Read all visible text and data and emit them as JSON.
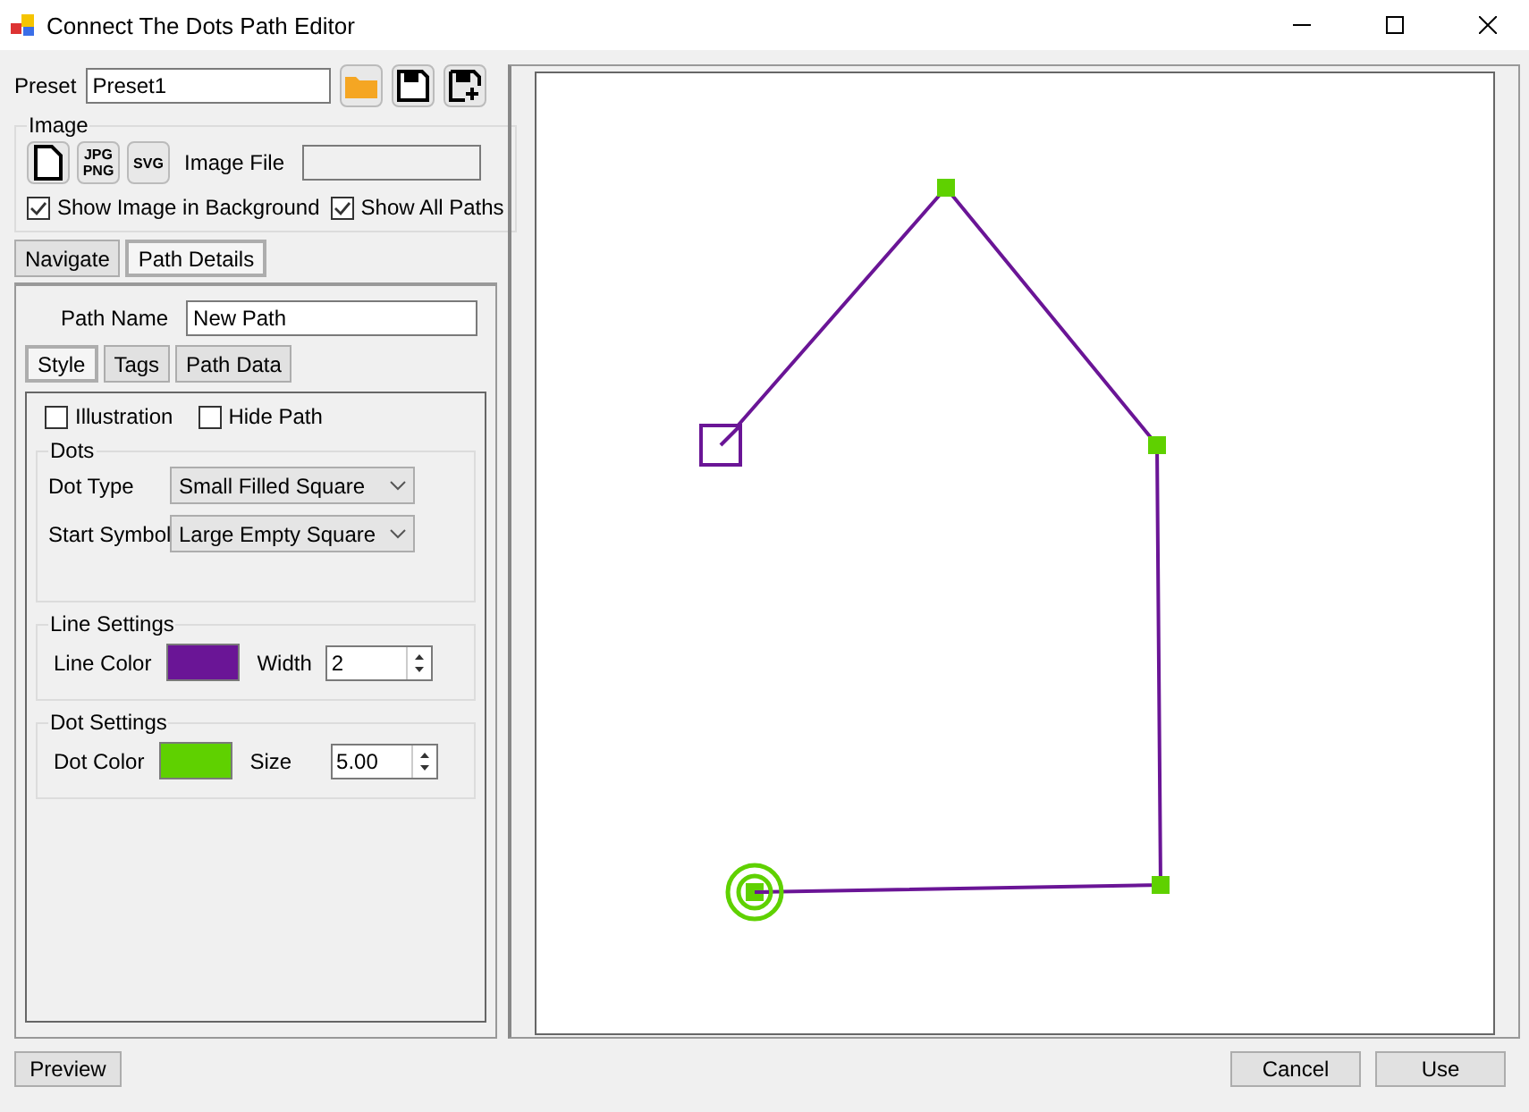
{
  "window": {
    "title": "Connect The Dots Path Editor"
  },
  "preset": {
    "label": "Preset",
    "value": "Preset1"
  },
  "image": {
    "title": "Image",
    "file_label": "Image File",
    "buttons": [
      {
        "kind": "file"
      },
      {
        "kind": "jpgpng",
        "lines": [
          "JPG",
          "PNG"
        ]
      },
      {
        "kind": "svg",
        "lines": [
          "SVG"
        ]
      }
    ],
    "options": [
      {
        "label": "Show Image in Background",
        "checked": true
      },
      {
        "label": "Show All Paths",
        "checked": true
      }
    ]
  },
  "tabs": [
    {
      "label": "Navigate",
      "selected": false
    },
    {
      "label": "Path Details",
      "selected": true
    }
  ],
  "path_name": {
    "label": "Path Name",
    "value": "New Path"
  },
  "subtabs": [
    {
      "label": "Style",
      "selected": true
    },
    {
      "label": "Tags",
      "selected": false
    },
    {
      "label": "Path Data",
      "selected": false
    }
  ],
  "style_options": [
    {
      "label": "Illustration",
      "checked": false
    },
    {
      "label": "Hide Path",
      "checked": false
    }
  ],
  "dots": {
    "title": "Dots",
    "fields": [
      {
        "label": "Dot Type",
        "value": "Small Filled Square"
      },
      {
        "label": "Start Symbol",
        "value": "Large Empty Square"
      }
    ]
  },
  "line_settings": {
    "title": "Line Settings",
    "color_label": "Line Color",
    "color": "#6a1596",
    "number_label": "Width",
    "number_value": "2"
  },
  "dot_settings": {
    "title": "Dot Settings",
    "color_label": "Dot Color",
    "color": "#5fd100",
    "number_label": "Size",
    "number_value": "5.00"
  },
  "buttons": {
    "left": [
      "Preview"
    ],
    "right": [
      "Cancel",
      "Use"
    ]
  }
}
